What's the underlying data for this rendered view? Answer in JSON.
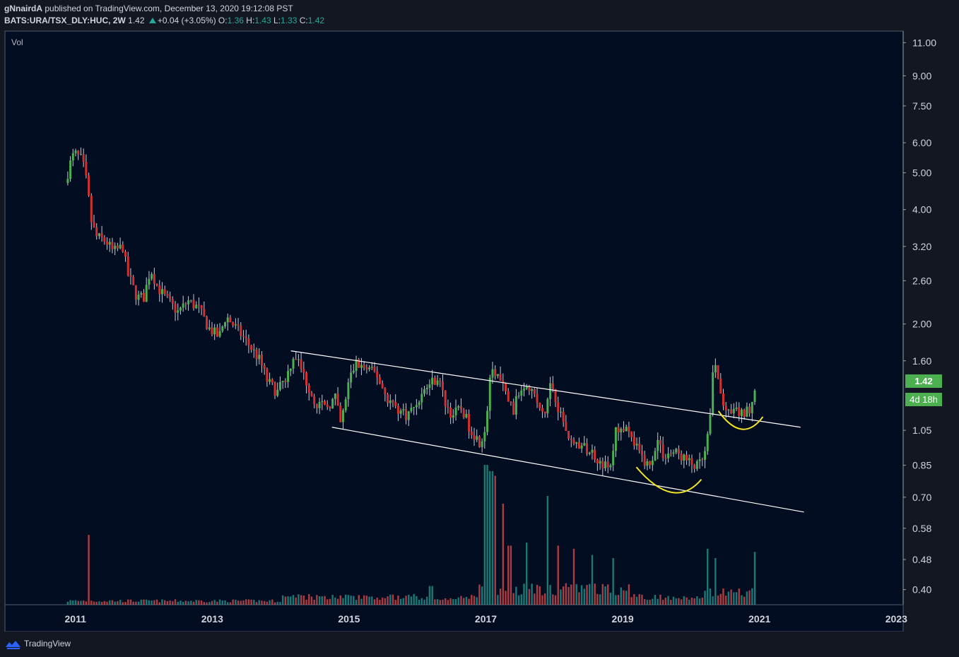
{
  "header": {
    "author": "gNnairdA",
    "published": "published on TradingView.com, December 13, 2020 19:12:08 PST",
    "symbol": "BATS:URA/TSX_DLY:HUC, 2W",
    "last": "1.42",
    "change": "+0.04 (+3.05%)",
    "o_label": "O:",
    "o": "1.36",
    "h_label": "H:",
    "h": "1.43",
    "l_label": "L:",
    "l": "1.33",
    "c_label": "C:",
    "c": "1.42"
  },
  "footer": {
    "brand": "TradingView"
  },
  "badges": {
    "price": "1.42",
    "countdown": "4d 18h"
  },
  "colors": {
    "background": "#131722",
    "plot": "#020d22",
    "up": "#4caf50",
    "down": "#d32f2f",
    "vol_up": "#26a69a",
    "vol_down": "#ef5350",
    "channel": "#ffffff",
    "curve": "#f5e625"
  },
  "chart_data": {
    "type": "candlestick",
    "interval": "2W",
    "yscale": "log",
    "ylim": [
      0.365,
      11.8
    ],
    "xlim": [
      2009.97,
      2023.1
    ],
    "indicator_label": "Vol",
    "y_ticks": [
      11.0,
      9.0,
      7.5,
      6.0,
      5.0,
      4.0,
      3.2,
      2.6,
      2.0,
      1.6,
      1.05,
      0.85,
      0.7,
      0.58,
      0.48,
      0.4
    ],
    "y_tick_labels": [
      "11.00",
      "9.00",
      "7.50",
      "6.00",
      "5.00",
      "4.00",
      "3.20",
      "2.60",
      "2.00",
      "1.60",
      "1.05",
      "0.85",
      "0.70",
      "0.58",
      "0.48",
      "0.40"
    ],
    "x_ticks": [
      2011,
      2013,
      2015,
      2017,
      2019,
      2021,
      2023
    ],
    "x_tick_labels": [
      "2011",
      "2013",
      "2015",
      "2017",
      "2019",
      "2021",
      "2023"
    ],
    "price_path": [
      [
        2010.85,
        4.7
      ],
      [
        2010.95,
        5.5
      ],
      [
        2011.0,
        5.6
      ],
      [
        2011.1,
        5.4
      ],
      [
        2011.18,
        4.55
      ],
      [
        2011.22,
        3.8
      ],
      [
        2011.3,
        3.4
      ],
      [
        2011.45,
        3.3
      ],
      [
        2011.55,
        3.1
      ],
      [
        2011.7,
        3.2
      ],
      [
        2011.75,
        2.75
      ],
      [
        2011.9,
        2.35
      ],
      [
        2012.0,
        2.35
      ],
      [
        2012.1,
        2.8
      ],
      [
        2012.2,
        2.5
      ],
      [
        2012.35,
        2.3
      ],
      [
        2012.5,
        2.15
      ],
      [
        2012.65,
        2.3
      ],
      [
        2012.8,
        2.2
      ],
      [
        2012.95,
        1.95
      ],
      [
        2013.1,
        1.85
      ],
      [
        2013.2,
        2.1
      ],
      [
        2013.4,
        1.9
      ],
      [
        2013.55,
        1.75
      ],
      [
        2013.7,
        1.6
      ],
      [
        2013.8,
        1.42
      ],
      [
        2013.95,
        1.32
      ],
      [
        2014.1,
        1.48
      ],
      [
        2014.2,
        1.68
      ],
      [
        2014.35,
        1.45
      ],
      [
        2014.5,
        1.25
      ],
      [
        2014.65,
        1.2
      ],
      [
        2014.8,
        1.28
      ],
      [
        2014.88,
        1.08
      ],
      [
        2015.0,
        1.42
      ],
      [
        2015.1,
        1.58
      ],
      [
        2015.25,
        1.52
      ],
      [
        2015.4,
        1.48
      ],
      [
        2015.55,
        1.28
      ],
      [
        2015.7,
        1.2
      ],
      [
        2015.85,
        1.15
      ],
      [
        2016.0,
        1.25
      ],
      [
        2016.15,
        1.38
      ],
      [
        2016.3,
        1.45
      ],
      [
        2016.4,
        1.25
      ],
      [
        2016.5,
        1.15
      ],
      [
        2016.65,
        1.2
      ],
      [
        2016.75,
        1.08
      ],
      [
        2016.9,
        0.98
      ],
      [
        2017.0,
        1.03
      ],
      [
        2017.05,
        1.45
      ],
      [
        2017.15,
        1.5
      ],
      [
        2017.3,
        1.3
      ],
      [
        2017.4,
        1.18
      ],
      [
        2017.5,
        1.35
      ],
      [
        2017.6,
        1.42
      ],
      [
        2017.75,
        1.25
      ],
      [
        2017.85,
        1.12
      ],
      [
        2017.95,
        1.42
      ],
      [
        2018.05,
        1.22
      ],
      [
        2018.15,
        1.08
      ],
      [
        2018.25,
        0.98
      ],
      [
        2018.4,
        0.95
      ],
      [
        2018.55,
        0.92
      ],
      [
        2018.7,
        0.86
      ],
      [
        2018.82,
        0.83
      ],
      [
        2018.9,
        1.05
      ],
      [
        2019.0,
        1.07
      ],
      [
        2019.15,
        0.98
      ],
      [
        2019.3,
        0.88
      ],
      [
        2019.4,
        0.84
      ],
      [
        2019.5,
        1.0
      ],
      [
        2019.6,
        0.9
      ],
      [
        2019.75,
        0.92
      ],
      [
        2019.85,
        0.9
      ],
      [
        2019.98,
        0.86
      ],
      [
        2020.1,
        0.84
      ],
      [
        2020.2,
        0.9
      ],
      [
        2020.28,
        1.15
      ],
      [
        2020.33,
        1.6
      ],
      [
        2020.38,
        1.48
      ],
      [
        2020.45,
        1.25
      ],
      [
        2020.55,
        1.15
      ],
      [
        2020.65,
        1.18
      ],
      [
        2020.75,
        1.15
      ],
      [
        2020.85,
        1.2
      ],
      [
        2020.92,
        1.32
      ],
      [
        2020.96,
        1.42
      ]
    ],
    "volume_spikes": [
      [
        2011.2,
        0.45
      ],
      [
        2016.2,
        0.12
      ],
      [
        2016.9,
        0.13
      ],
      [
        2017.0,
        0.9
      ],
      [
        2017.08,
        0.86
      ],
      [
        2017.15,
        0.83
      ],
      [
        2017.25,
        0.65
      ],
      [
        2017.35,
        0.38
      ],
      [
        2017.6,
        0.4
      ],
      [
        2017.9,
        0.7
      ],
      [
        2018.05,
        0.38
      ],
      [
        2018.3,
        0.36
      ],
      [
        2018.55,
        0.32
      ],
      [
        2018.85,
        0.3
      ],
      [
        2020.25,
        0.36
      ],
      [
        2020.35,
        0.3
      ],
      [
        2020.95,
        0.34
      ]
    ],
    "annotations": {
      "channel_upper": [
        [
          2014.15,
          1.7
        ],
        [
          2021.6,
          1.07
        ]
      ],
      "channel_lower": [
        [
          2014.75,
          1.07
        ],
        [
          2021.65,
          0.64
        ]
      ],
      "curves": [
        [
          [
            2019.2,
            0.84
          ],
          [
            2019.75,
            0.7
          ],
          [
            2020.15,
            0.78
          ]
        ],
        [
          [
            2020.4,
            1.18
          ],
          [
            2020.75,
            1.05
          ],
          [
            2021.05,
            1.14
          ]
        ]
      ]
    }
  }
}
